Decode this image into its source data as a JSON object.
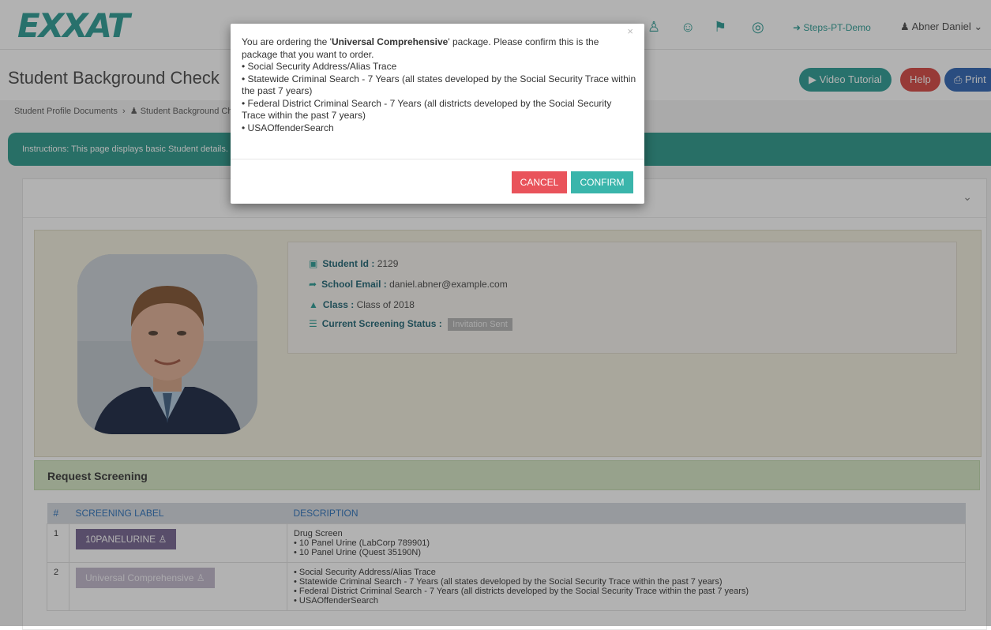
{
  "app": {
    "logo": "EXXAT",
    "nav_site": "Steps-PT-Demo",
    "nav_user": "Abner Daniel"
  },
  "page": {
    "title": "Student Background Check",
    "buttons": {
      "video": "Video Tutorial",
      "help": "Help",
      "print": "Print"
    },
    "breadcrumb": [
      "Student Profile Documents",
      "Student Background Check"
    ],
    "instructions": "Instructions: This page displays basic Student details."
  },
  "profile": {
    "student_id_label": "Student Id :",
    "student_id": "2129",
    "email_label": "School Email :",
    "email": "daniel.abner@example.com",
    "class_label": "Class :",
    "class": "Class of 2018",
    "status_label": "Current Screening Status :",
    "status": "Invitation Sent"
  },
  "screening": {
    "title": "Request Screening",
    "columns": [
      "#",
      "SCREENING LABEL",
      "DESCRIPTION"
    ],
    "rows": [
      {
        "num": "1",
        "label": "10PANELURINE",
        "lines": [
          "Drug Screen",
          "• 10 Panel Urine (LabCorp 789901)",
          "• 10 Panel Urine (Quest 35190N)"
        ]
      },
      {
        "num": "2",
        "label": "Universal Comprehensive",
        "lines": [
          "• Social Security Address/Alias Trace",
          "• Statewide Criminal Search - 7 Years (all states developed by the Social Security Trace within the past 7 years)",
          "• Federal District Criminal Search - 7 Years (all districts developed by the Social Security Trace within the past 7 years)",
          "• USAOffenderSearch"
        ]
      }
    ]
  },
  "modal": {
    "intro_pre": "You are ordering the '",
    "package": "Universal Comprehensive",
    "intro_post": "' package. Please confirm this is the package that you want to order.",
    "items": [
      "• Social Security Address/Alias Trace",
      "• Statewide Criminal Search - 7 Years (all states developed by the Social Security Trace within the past 7 years)",
      "• Federal District Criminal Search - 7 Years (all districts developed by the Social Security Trace within the past 7 years)",
      "• USAOffenderSearch"
    ],
    "close": "×",
    "cancel": "CANCEL",
    "confirm": "CONFIRM"
  },
  "colors": {
    "brand": "#3aa39b",
    "cancel": "#e9535b",
    "confirm": "#3ab5ab",
    "help": "#d9534f",
    "print": "#3d6fb8"
  }
}
